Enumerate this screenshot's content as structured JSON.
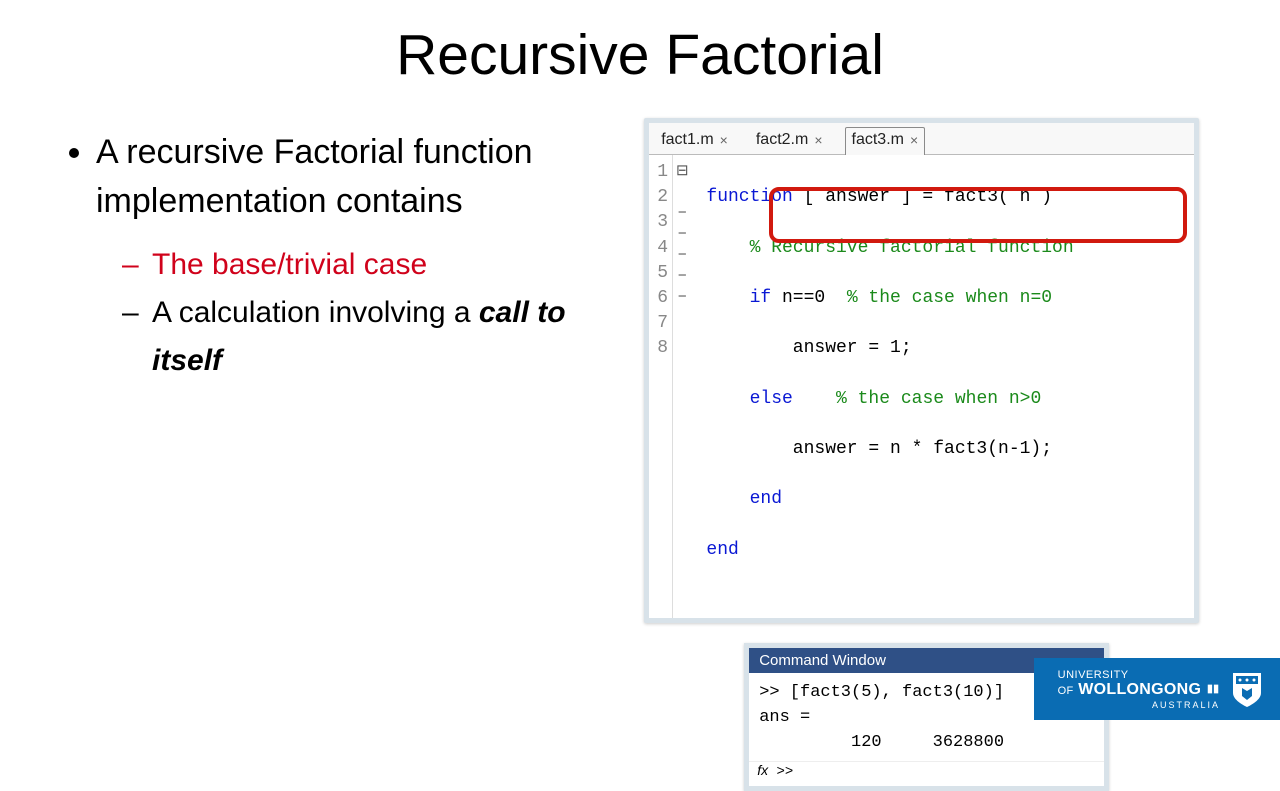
{
  "title": "Recursive Factorial",
  "bullets": {
    "main": "A recursive Factorial function implementation contains",
    "sub1": "The base/trivial case",
    "sub2_prefix": "A calculation involving a ",
    "sub2_em": "call to itself"
  },
  "editor": {
    "tabs": [
      {
        "label": "fact1.m",
        "active": false
      },
      {
        "label": "fact2.m",
        "active": false
      },
      {
        "label": "fact3.m",
        "active": true
      }
    ],
    "line_numbers": [
      "1",
      "2",
      "3",
      "4",
      "5",
      "6",
      "7",
      "8"
    ],
    "fold": [
      "⊟",
      "",
      "−",
      "−",
      "−",
      "−",
      "−",
      ""
    ],
    "code": {
      "l1_kw": "function",
      "l1_rest": " [ answer ] = fact3( n )",
      "l2_cm": "% Recursive factorial function",
      "l3_kw": "if",
      "l3_mid": " n==0  ",
      "l3_cm": "% the case when n=0",
      "l4": "answer = 1;",
      "l5_kw": "else",
      "l5_sp": "    ",
      "l5_cm": "% the case when n>0",
      "l6": "answer = n * fact3(n-1);",
      "l7_kw": "end",
      "l8_kw": "end"
    }
  },
  "command": {
    "title": "Command Window",
    "line1": ">> [fact3(5), fact3(10)]",
    "line2": "ans =",
    "line3": "         120     3628800",
    "fx_prompt": "fx >>"
  },
  "footer": {
    "line1": "UNIVERSITY",
    "line2_a": "OF",
    "line2_b": "WOLLONGONG",
    "line3": "AUSTRALIA"
  }
}
